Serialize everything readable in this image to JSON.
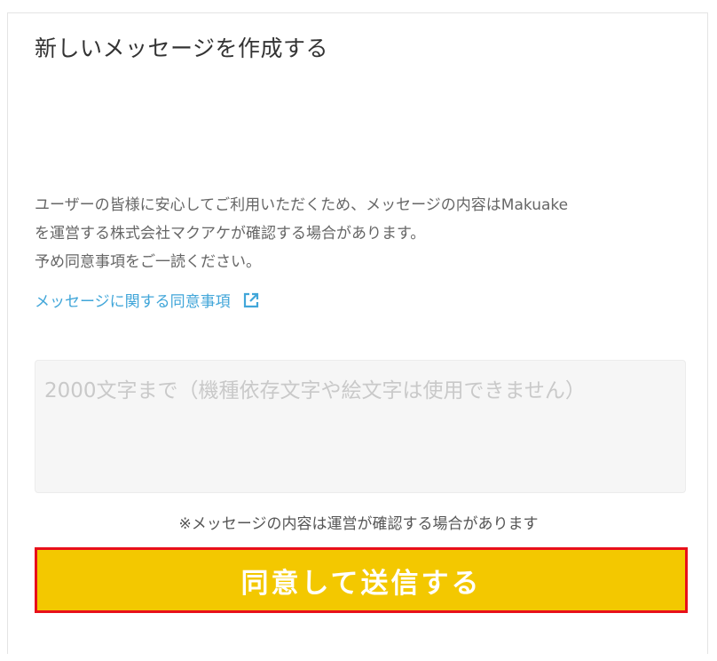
{
  "card": {
    "title": "新しいメッセージを作成する"
  },
  "notice": {
    "line1": "ユーザーの皆様に安心してご利用いただくため、メッセージの内容はMakuake",
    "line2": "を運営する株式会社マクアケが確認する場合があります。",
    "line3": "予め同意事項をご一読ください。"
  },
  "agree_link": {
    "label": "メッセージに関する同意事項",
    "icon": "external-link-icon",
    "color": "#41a6d9"
  },
  "message_input": {
    "placeholder": "2000文字まで（機種依存文字や絵文字は使用できません）",
    "value": ""
  },
  "sub_note": "※メッセージの内容は運営が確認する場合があります",
  "submit": {
    "label": "同意して送信する",
    "background": "#f3c800",
    "highlight_border": "#e8101a"
  }
}
